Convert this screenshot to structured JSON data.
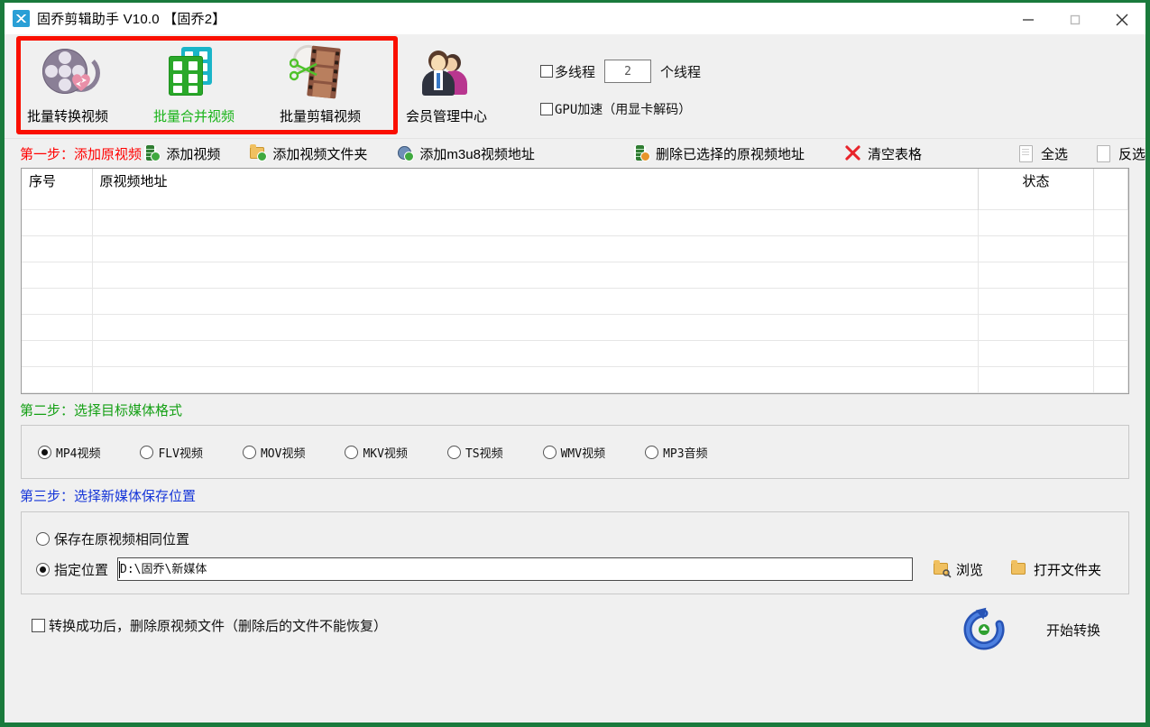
{
  "window": {
    "title": "固乔剪辑助手 V10.0  【固乔2】",
    "icon": "app-scissors-icon",
    "minimize": "—",
    "maximize": "□",
    "close": "✕",
    "border_color": "#1a7a3c",
    "highlight_color": "#fa0f00"
  },
  "toolbar": {
    "tools": [
      {
        "label": "批量转换视频",
        "icon": "film-reel-convert-icon",
        "active": false
      },
      {
        "label": "批量合并视频",
        "icon": "merge-blocks-icon",
        "active": true
      },
      {
        "label": "批量剪辑视频",
        "icon": "scissors-filmstrip-icon",
        "active": false
      },
      {
        "label": "会员管理中心",
        "icon": "members-icon",
        "active": false
      }
    ],
    "options": {
      "multithread": {
        "label": "多线程",
        "checked": false,
        "value": "2",
        "unit": "个线程"
      },
      "gpu": {
        "label": "GPU加速（用显卡解码）",
        "checked": false
      }
    }
  },
  "step1": {
    "title": "第一步：添加原视频",
    "actions": [
      {
        "label": "添加视频",
        "icon": "add-video-icon"
      },
      {
        "label": "添加视频文件夹",
        "icon": "add-folder-icon"
      },
      {
        "label": "添加m3u8视频地址",
        "icon": "add-m3u8-icon"
      },
      {
        "label": "删除已选择的原视频地址",
        "icon": "delete-selected-icon"
      },
      {
        "label": "清空表格",
        "icon": "clear-table-icon"
      },
      {
        "label": "全选",
        "icon": "select-all-icon"
      },
      {
        "label": "反选",
        "icon": "invert-selection-icon"
      }
    ]
  },
  "table": {
    "columns": [
      "序号",
      "原视频地址",
      "状态"
    ],
    "rows": [],
    "empty_row_count": 9
  },
  "step2": {
    "title": "第二步：选择目标媒体格式",
    "formats": [
      {
        "label": "MP4视频",
        "selected": true
      },
      {
        "label": "FLV视频",
        "selected": false
      },
      {
        "label": "MOV视频",
        "selected": false
      },
      {
        "label": "MKV视频",
        "selected": false
      },
      {
        "label": "TS视频",
        "selected": false
      },
      {
        "label": "WMV视频",
        "selected": false
      },
      {
        "label": "MP3音频",
        "selected": false
      }
    ]
  },
  "step3": {
    "title": "第三步：选择新媒体保存位置",
    "same_location": {
      "label": "保存在原视频相同位置",
      "selected": false
    },
    "custom_location": {
      "label": "指定位置",
      "selected": true,
      "path": "D:\\固乔\\新媒体"
    },
    "browse": {
      "label": "浏览",
      "icon": "browse-folder-icon"
    },
    "open_folder": {
      "label": "打开文件夹",
      "icon": "open-folder-icon"
    }
  },
  "bottom": {
    "delete_after": {
      "label": "转换成功后，删除原视频文件（删除后的文件不能恢复）",
      "checked": false
    },
    "start": {
      "label": "开始转换",
      "icon": "start-convert-icon"
    }
  }
}
